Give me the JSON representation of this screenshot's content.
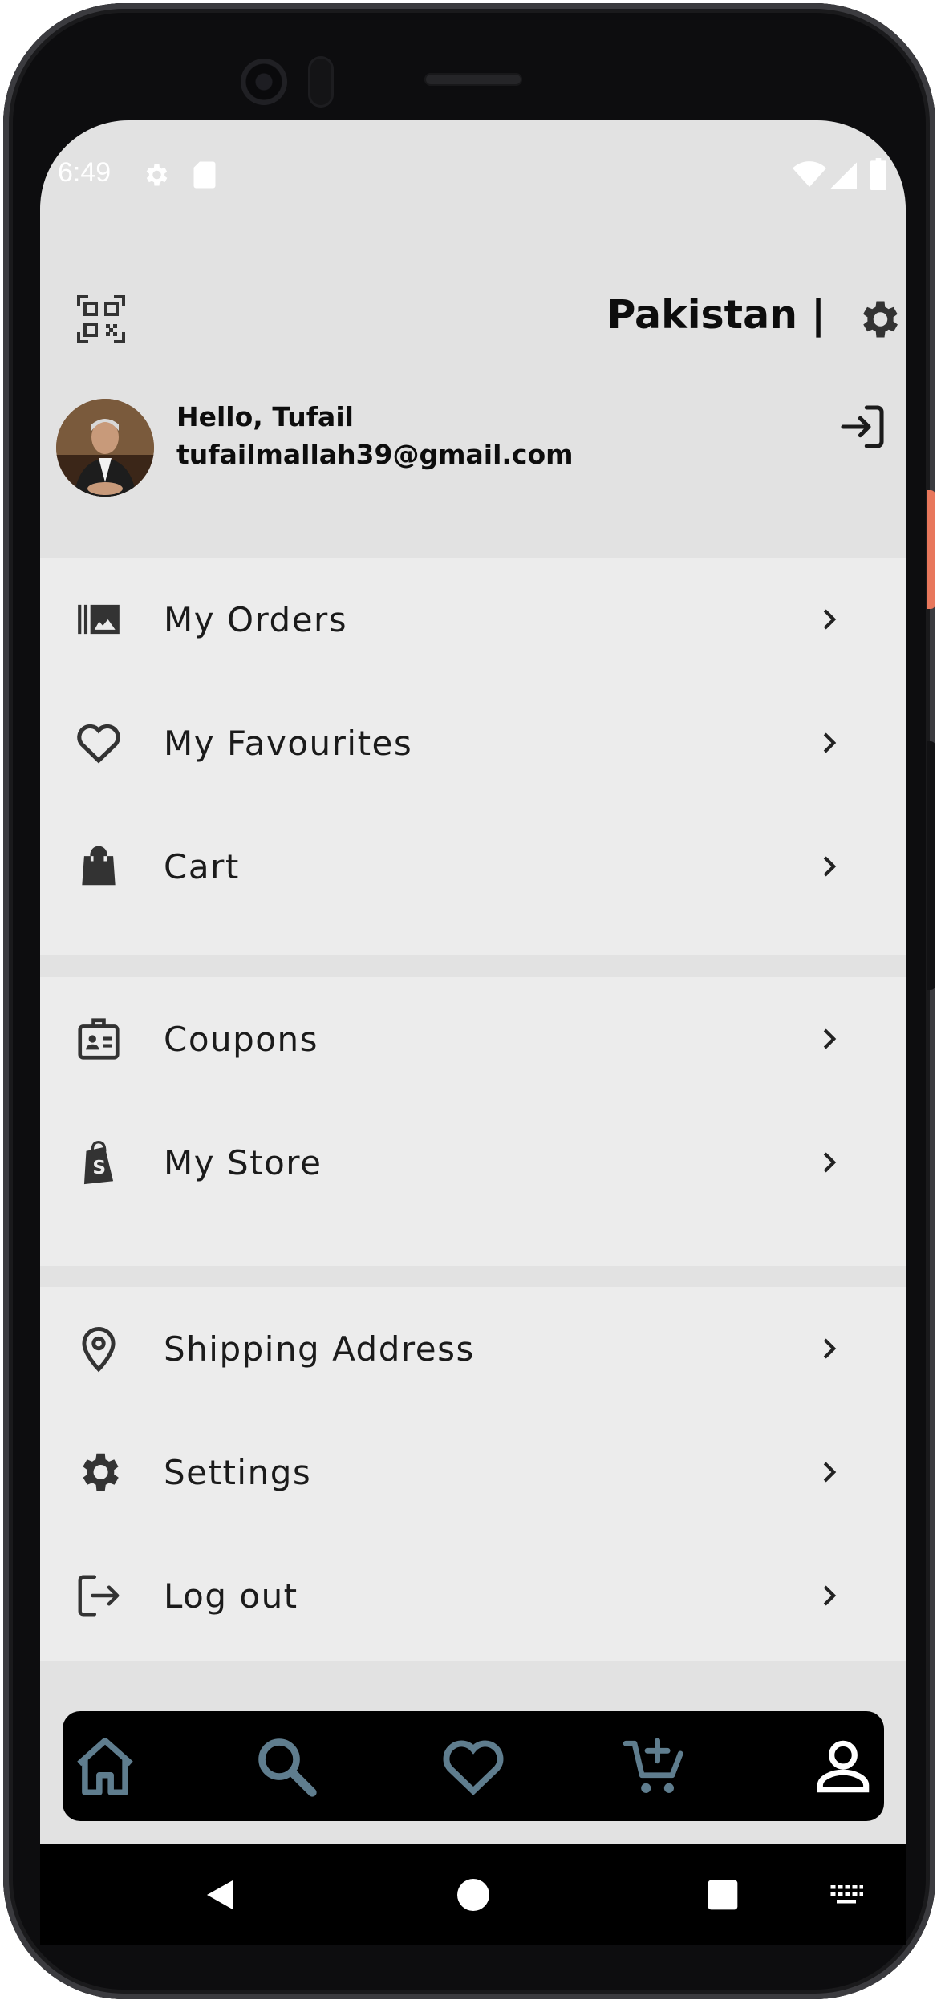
{
  "status_bar": {
    "time": "6:49",
    "icons": [
      "gear-icon",
      "sd-card-icon",
      "wifi-icon",
      "signal-icon",
      "battery-icon"
    ]
  },
  "header": {
    "country_label": "Pakistan |",
    "qr_icon": "qr-scan-icon",
    "settings_icon": "gear-icon"
  },
  "profile": {
    "greeting": "Hello, Tufail",
    "email": "tufailmallah39@gmail.com",
    "login_icon": "login-icon"
  },
  "menu": {
    "groups": [
      [
        {
          "label": "My Orders",
          "icon": "photo-library-icon"
        },
        {
          "label": "My Favourites",
          "icon": "heart-outline-icon"
        },
        {
          "label": "Cart",
          "icon": "shopping-bag-icon"
        }
      ],
      [
        {
          "label": "Coupons",
          "icon": "id-badge-icon"
        },
        {
          "label": "My Store",
          "icon": "shopify-icon"
        }
      ],
      [
        {
          "label": "Shipping Address",
          "icon": "location-pin-icon"
        },
        {
          "label": "Settings",
          "icon": "gear-icon"
        },
        {
          "label": "Log out",
          "icon": "logout-icon"
        }
      ]
    ]
  },
  "bottom_nav": {
    "items": [
      "home-icon",
      "search-icon",
      "heart-icon",
      "add-to-cart-icon",
      "profile-icon"
    ],
    "active_index": 4,
    "inactive_color": "#5f7d8e",
    "active_color": "#ffffff"
  },
  "colors": {
    "menu_bg": "#ececec",
    "screen_bg": "#e2e2e2",
    "text": "#1b1b1b"
  }
}
